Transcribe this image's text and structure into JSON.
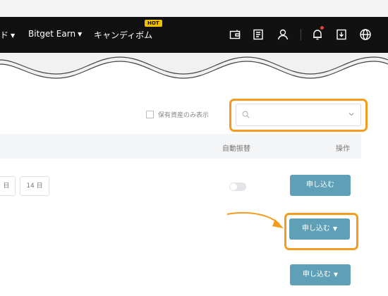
{
  "navbar": {
    "items": [
      {
        "label": "ド",
        "has_caret": true
      },
      {
        "label": "Bitget Earn",
        "has_caret": true
      },
      {
        "label": "キャンディボム",
        "badge": "HOT"
      }
    ],
    "icons": [
      "wallet-icon",
      "orders-icon",
      "user-icon",
      "bell-icon",
      "download-icon",
      "globe-icon"
    ],
    "notification_dot": true
  },
  "filters": {
    "show_own_assets_label": "保有資産のみ表示",
    "search_placeholder": ""
  },
  "table": {
    "headers": {
      "auto_renew": "自動振替",
      "action": "操作"
    }
  },
  "rows": [
    {
      "date_chips": [
        "日",
        "14 日"
      ],
      "auto_renew_on": false,
      "button": "申し込む",
      "has_dropdown": false
    },
    {
      "button": "申し込む",
      "has_dropdown": true,
      "highlighted": true
    },
    {
      "button": "申し込む",
      "has_dropdown": true
    }
  ],
  "colors": {
    "highlight": "#f39c1f",
    "button": "#5fa0b7",
    "navbar": "#111111"
  }
}
